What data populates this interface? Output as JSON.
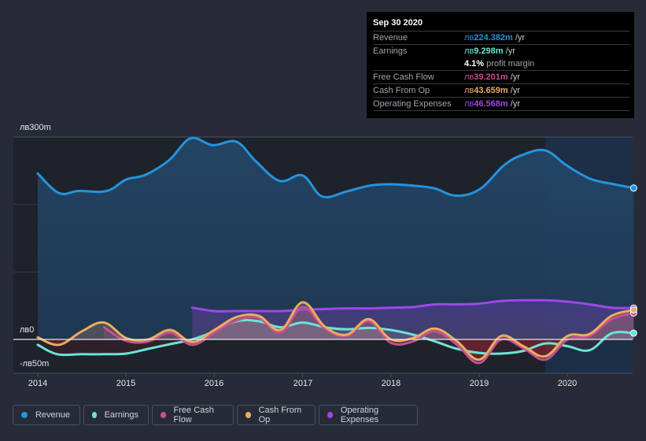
{
  "tooltip": {
    "date": "Sep 30 2020",
    "rows": [
      {
        "label": "Revenue",
        "currency": "лв",
        "value": "224.382m",
        "unit": " /yr",
        "color": "#2394df"
      },
      {
        "label": "Earnings",
        "currency": "лв",
        "value": "9.298m",
        "unit": " /yr",
        "color": "#6ce3d6"
      },
      {
        "label": "",
        "currency": "",
        "value": "4.1%",
        "unit": " profit margin",
        "color": "#ffffff"
      },
      {
        "label": "Free Cash Flow",
        "currency": "лв",
        "value": "39.201m",
        "unit": " /yr",
        "color": "#c94f8f"
      },
      {
        "label": "Cash From Op",
        "currency": "лв",
        "value": "43.659m",
        "unit": " /yr",
        "color": "#e8ae5f"
      },
      {
        "label": "Operating Expenses",
        "currency": "лв",
        "value": "46.568m",
        "unit": " /yr",
        "color": "#a046e8"
      }
    ]
  },
  "legend": [
    {
      "label": "Revenue",
      "color": "#2394df"
    },
    {
      "label": "Earnings",
      "color": "#6ce3d6"
    },
    {
      "label": "Free Cash Flow",
      "color": "#c94f8f"
    },
    {
      "label": "Cash From Op",
      "color": "#e8ae5f"
    },
    {
      "label": "Operating Expenses",
      "color": "#a046e8"
    }
  ],
  "chart_data": {
    "type": "area",
    "title": "",
    "xlabel": "",
    "ylabel": "",
    "ylim": [
      -50,
      300
    ],
    "xlim": [
      2013.7,
      2020.75
    ],
    "y_tick_labels": [
      {
        "value": 300,
        "label": "лв300m"
      },
      {
        "value": 0,
        "label": "лв0"
      },
      {
        "value": -50,
        "label": "-лв50m"
      }
    ],
    "gridlines": [
      100,
      200,
      300
    ],
    "x_tick_labels": [
      "2014",
      "2015",
      "2016",
      "2017",
      "2018",
      "2019",
      "2020"
    ],
    "forecast_shade_start": 2019.75,
    "legend_position": "bottom",
    "series": [
      {
        "name": "Revenue",
        "color": "#2394df",
        "x": [
          2014.0,
          2014.24,
          2014.46,
          2014.78,
          2015.0,
          2015.22,
          2015.49,
          2015.73,
          2015.98,
          2016.25,
          2016.47,
          2016.74,
          2017.0,
          2017.22,
          2017.49,
          2017.76,
          2018.0,
          2018.25,
          2018.49,
          2018.74,
          2019.01,
          2019.28,
          2019.5,
          2019.75,
          2019.99,
          2020.26,
          2020.53,
          2020.75
        ],
        "values": [
          246,
          217,
          220,
          220,
          237,
          244,
          266,
          298,
          288,
          293,
          264,
          235,
          243,
          212,
          219,
          228,
          230,
          228,
          224,
          213,
          223,
          258,
          274,
          280,
          258,
          238,
          230,
          224.4
        ]
      },
      {
        "name": "Earnings",
        "color": "#6ce3d6",
        "x": [
          2014.0,
          2014.22,
          2014.5,
          2014.75,
          2015.0,
          2015.25,
          2015.5,
          2015.75,
          2016.0,
          2016.25,
          2016.5,
          2016.75,
          2017.0,
          2017.25,
          2017.5,
          2017.75,
          2018.0,
          2018.25,
          2018.5,
          2018.75,
          2019.0,
          2019.25,
          2019.5,
          2019.75,
          2020.0,
          2020.25,
          2020.5,
          2020.75
        ],
        "values": [
          -8,
          -22,
          -22,
          -22,
          -21,
          -14,
          -7,
          0,
          12,
          27,
          27,
          18,
          25,
          18,
          15,
          17,
          14,
          7,
          -3,
          -14,
          -20,
          -21,
          -17,
          -6,
          -10,
          -16,
          9,
          9.3
        ]
      },
      {
        "name": "Free Cash Flow",
        "color": "#c94f8f",
        "x": [
          2014.75,
          2015.0,
          2015.25,
          2015.5,
          2015.75,
          2016.0,
          2016.25,
          2016.5,
          2016.75,
          2017.0,
          2017.25,
          2017.5,
          2017.75,
          2018.0,
          2018.25,
          2018.5,
          2018.75,
          2019.0,
          2019.25,
          2019.5,
          2019.75,
          2020.0,
          2020.25,
          2020.5,
          2020.75
        ],
        "values": [
          18,
          -2,
          -3,
          10,
          -8,
          10,
          28,
          32,
          10,
          48,
          16,
          5,
          27,
          -5,
          -3,
          12,
          -8,
          -35,
          0,
          -13,
          -30,
          0,
          5,
          30,
          39.2
        ]
      },
      {
        "name": "Cash From Op",
        "color": "#e8ae5f",
        "x": [
          2014.0,
          2014.24,
          2014.5,
          2014.75,
          2015.0,
          2015.25,
          2015.5,
          2015.75,
          2016.0,
          2016.25,
          2016.5,
          2016.75,
          2017.0,
          2017.25,
          2017.5,
          2017.75,
          2018.0,
          2018.25,
          2018.5,
          2018.75,
          2019.0,
          2019.25,
          2019.5,
          2019.75,
          2020.0,
          2020.25,
          2020.5,
          2020.75
        ],
        "values": [
          3,
          -8,
          12,
          25,
          2,
          0,
          14,
          -4,
          14,
          33,
          35,
          14,
          55,
          19,
          7,
          30,
          0,
          2,
          16,
          -3,
          -30,
          5,
          -10,
          -25,
          5,
          8,
          35,
          43.7
        ]
      },
      {
        "name": "Operating Expenses",
        "color": "#a046e8",
        "x": [
          2015.75,
          2016.0,
          2016.25,
          2016.5,
          2016.75,
          2017.0,
          2017.25,
          2017.5,
          2017.75,
          2018.0,
          2018.25,
          2018.5,
          2018.75,
          2019.0,
          2019.25,
          2019.5,
          2019.75,
          2020.0,
          2020.25,
          2020.5,
          2020.75
        ],
        "values": [
          47,
          42,
          42,
          42,
          42,
          44,
          45,
          46,
          46,
          47,
          48,
          52,
          52,
          53,
          57,
          58,
          58,
          56,
          52,
          47,
          46.6
        ]
      }
    ]
  }
}
